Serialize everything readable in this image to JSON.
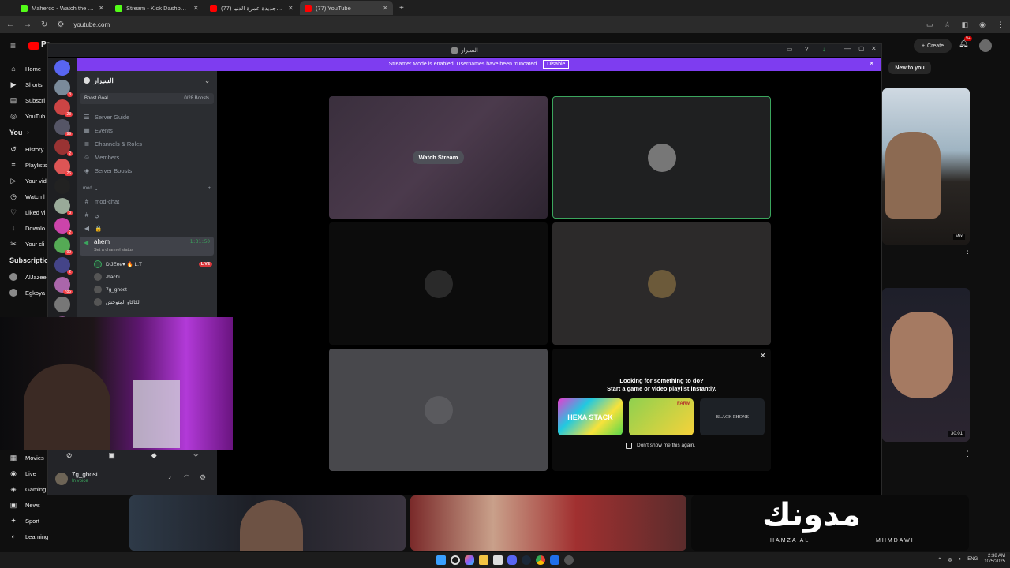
{
  "browser": {
    "tabs": [
      {
        "title": "Maherco - Watch the VOD on K",
        "color": "#53fc18",
        "active": false
      },
      {
        "title": "Stream - Kick Dashboard",
        "color": "#53fc18",
        "active": false
      },
      {
        "title": "لعبة جديدة عمرة الدنيا (77)",
        "color": "#ff0000",
        "active": false
      },
      {
        "title": "(77) YouTube",
        "color": "#ff0000",
        "active": true
      }
    ],
    "url": "youtube.com"
  },
  "youtube": {
    "brand": "Pr",
    "create_label": "Create",
    "notif_count": "9+",
    "chip_label": "New to you",
    "sidebar": {
      "top": [
        {
          "label": "Home",
          "icon": "home-icon",
          "glyph": "⌂"
        },
        {
          "label": "Shorts",
          "icon": "shorts-icon",
          "glyph": "▶"
        },
        {
          "label": "Subscri",
          "icon": "subscriptions-icon",
          "glyph": "▤"
        },
        {
          "label": "YouTub",
          "icon": "youtube-music-icon",
          "glyph": "◎"
        }
      ],
      "you_label": "You",
      "you": [
        {
          "label": "History",
          "icon": "history-icon",
          "glyph": "↺"
        },
        {
          "label": "Playlists",
          "icon": "playlists-icon",
          "glyph": "≡"
        },
        {
          "label": "Your vid",
          "icon": "your-videos-icon",
          "glyph": "▷"
        },
        {
          "label": "Watch l",
          "icon": "watch-later-icon",
          "glyph": "◷"
        },
        {
          "label": "Liked vi",
          "icon": "liked-icon",
          "glyph": "♡"
        },
        {
          "label": "Downlo",
          "icon": "download-icon",
          "glyph": "↓"
        },
        {
          "label": "Your cli",
          "icon": "clips-icon",
          "glyph": "✂"
        }
      ],
      "subs_label": "Subscriptions",
      "subs": [
        {
          "label": "AlJazee",
          "icon": "channel-avatar-icon"
        },
        {
          "label": "Egkoya",
          "icon": "channel-avatar-icon"
        }
      ],
      "explore": [
        {
          "label": "Movies",
          "icon": "movies-icon",
          "glyph": "▦"
        },
        {
          "label": "Live",
          "icon": "live-icon",
          "glyph": "◉"
        },
        {
          "label": "Gaming",
          "icon": "gaming-icon",
          "glyph": "◈"
        },
        {
          "label": "News",
          "icon": "news-icon",
          "glyph": "▣"
        },
        {
          "label": "Sport",
          "icon": "sport-icon",
          "glyph": "✦"
        },
        {
          "label": "Learning",
          "icon": "learning-icon",
          "glyph": "◐"
        }
      ]
    },
    "right_video": {
      "badge": "Mix",
      "duration": "30:01"
    },
    "bottom_thumb_text": {
      "big": "مدونك",
      "left": "HAMZA AL",
      "right": "MHMDAWI"
    }
  },
  "discord": {
    "window_title": "السيزار",
    "streamer_banner": "Streamer Mode is enabled. Usernames have been truncated.",
    "disable_label": "Disable",
    "server_name": "السيزار",
    "boost_goal": {
      "label": "Boost Goal",
      "value": "0/28 Boosts"
    },
    "menu": [
      {
        "label": "Server Guide",
        "glyph": "☰"
      },
      {
        "label": "Events",
        "glyph": "▦"
      },
      {
        "label": "Channels & Roles",
        "glyph": "≣"
      },
      {
        "label": "Members",
        "glyph": "☺"
      },
      {
        "label": "Server Boosts",
        "glyph": "◈"
      }
    ],
    "category": "mod",
    "channels": [
      {
        "label": "mod-chat",
        "glyph": "#"
      },
      {
        "label": "ي",
        "glyph": "#"
      },
      {
        "label": "🔒",
        "glyph": "◀"
      }
    ],
    "voice": {
      "name": "ahem",
      "time": "1:31:50",
      "status": "Set a channel status"
    },
    "voice_users": [
      {
        "name": "DiJEee♥ 🔥 L.T",
        "live": "LIVE"
      },
      {
        "name": "-hachi..",
        "live": ""
      },
      {
        "name": "7g_ghost",
        "live": ""
      },
      {
        "name": "الكاكاو المتوحش",
        "live": ""
      }
    ],
    "watch_stream": "Watch Stream",
    "suggestion": {
      "line1": "Looking for something to do?",
      "line2": "Start a game or video playlist instantly.",
      "checkbox": "Don't show me this again."
    },
    "games": [
      "HEXA STACK",
      "FARM",
      "BLACK PHONE"
    ],
    "user": {
      "name": "7g_ghost",
      "status": "In voice"
    },
    "guild_badges": [
      "3",
      "23",
      "99",
      "2",
      "26",
      "",
      "3",
      "2",
      "99",
      "2",
      "785",
      "",
      "99",
      "2"
    ]
  },
  "taskbar": {
    "lang": "ENG",
    "time": "2:38 AM",
    "date": "10/5/2025"
  }
}
